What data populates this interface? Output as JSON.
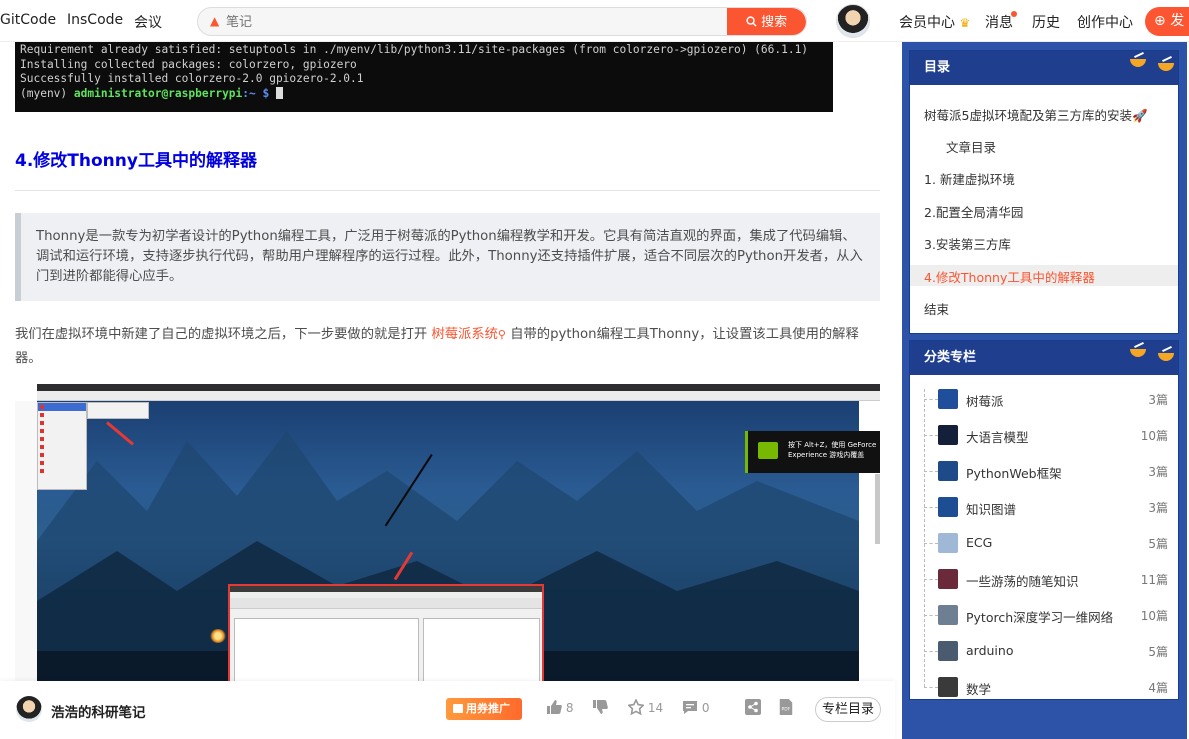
{
  "topbar": {
    "nav": [
      "GitCode",
      "InsCode",
      "会议"
    ],
    "search_placeholder": "笔记",
    "search_button": "搜索",
    "right_links": [
      "会员中心",
      "消息",
      "历史",
      "创作中心"
    ],
    "publish": "发"
  },
  "article": {
    "terminal_lines": [
      "Requirement already satisfied: setuptools in ./myenv/lib/python3.11/site-packages (from colorzero->gpiozero) (66.1.1)",
      "Installing collected packages: colorzero, gpiozero",
      "Successfully installed colorzero-2.0 gpiozero-2.0.1"
    ],
    "prompt_env": "(myenv) ",
    "prompt_user": "administrator@raspberrypi",
    "prompt_path": ":~ $ ",
    "heading": "4.修改Thonny工具中的解释器",
    "quote": "Thonny是一款专为初学者设计的Python编程工具，广泛用于树莓派的Python编程教学和开发。它具有简洁直观的界面，集成了代码编辑、调试和运行环境，支持逐步执行代码，帮助用户理解程序的运行过程。此外，Thonny还支持插件扩展，适合不同层次的Python开发者，从入门到进阶都能得心应手。",
    "para_before": "我们在虚拟环境中新建了自己的虚拟环境之后，下一步要做的就是打开 ",
    "para_link": "树莓派系统",
    "para_after": " 自带的python编程工具Thonny，让设置该工具使用的解释器。",
    "image_notification": "按下 Alt+Z，使用 GeForce Experience 游戏内覆盖"
  },
  "bottom": {
    "author": "浩浩的科研笔记",
    "promo": "用券推广",
    "likes": "8",
    "favorites": "14",
    "comments": "0",
    "column_toc": "专栏目录"
  },
  "toc": {
    "title": "目录",
    "items": [
      "树莓派5虚拟环境配及第三方库的安装🚀",
      "文章目录",
      "1. 新建虚拟环境",
      "2.配置全局清华园",
      "3.安装第三方库",
      "4.修改Thonny工具中的解释器",
      "结束"
    ],
    "active_index": 5
  },
  "categories": {
    "title": "分类专栏",
    "items": [
      {
        "name": "树莓派",
        "count": "3篇",
        "color": "#1f4f9a"
      },
      {
        "name": "大语言模型",
        "count": "10篇",
        "color": "#141f3a"
      },
      {
        "name": "PythonWeb框架",
        "count": "3篇",
        "color": "#1e4a8a"
      },
      {
        "name": "知识图谱",
        "count": "3篇",
        "color": "#1d4d92"
      },
      {
        "name": "ECG",
        "count": "5篇",
        "color": "#9fb8d6"
      },
      {
        "name": "一些游荡的随笔知识",
        "count": "11篇",
        "color": "#6a2a3a"
      },
      {
        "name": "Pytorch深度学习一维网络",
        "count": "10篇",
        "color": "#6e7f93"
      },
      {
        "name": "arduino",
        "count": "5篇",
        "color": "#4a5b70"
      },
      {
        "name": "数学",
        "count": "4篇",
        "color": "#3a3a3a"
      }
    ]
  },
  "colors": {
    "accent": "#fc5531",
    "heading_blue": "#0000e0",
    "sidebar_blue": "#2c53a7"
  }
}
